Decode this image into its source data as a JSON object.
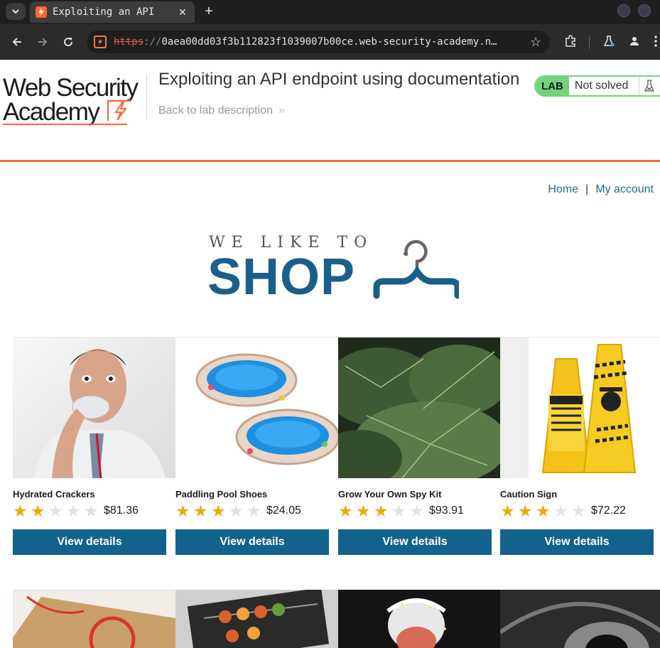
{
  "browser": {
    "tab_title": "Exploiting an API",
    "url_scheme": "https",
    "url_sep": "://",
    "url_rest": "0aea00dd03f3b112823f1039007b00ce.web-security-academy.n…"
  },
  "header": {
    "logo_line1": "Web Security",
    "logo_line2": "Academy",
    "lab_title": "Exploiting an API endpoint using documentation",
    "back_link": "Back to lab description",
    "back_chevrons": "»",
    "status_tag": "LAB",
    "status_text": "Not solved"
  },
  "nav": {
    "home": "Home",
    "separator": "|",
    "account": "My account"
  },
  "banner": {
    "small": "WE LIKE TO",
    "big": "SHOP"
  },
  "products": [
    {
      "name": "Hydrated Crackers",
      "rating": 2,
      "price": "$81.36",
      "button": "View details"
    },
    {
      "name": "Paddling Pool Shoes",
      "rating": 3,
      "price": "$24.05",
      "button": "View details"
    },
    {
      "name": "Grow Your Own Spy Kit",
      "rating": 3,
      "price": "$93.91",
      "button": "View details"
    },
    {
      "name": "Caution Sign",
      "rating": 3,
      "price": "$72.22",
      "button": "View details"
    }
  ],
  "colors": {
    "brand_orange": "#ff6633",
    "link_blue": "#1a6b98",
    "button_blue": "#12628e",
    "star_gold": "#f0a80c",
    "lab_green": "#73d37b"
  }
}
